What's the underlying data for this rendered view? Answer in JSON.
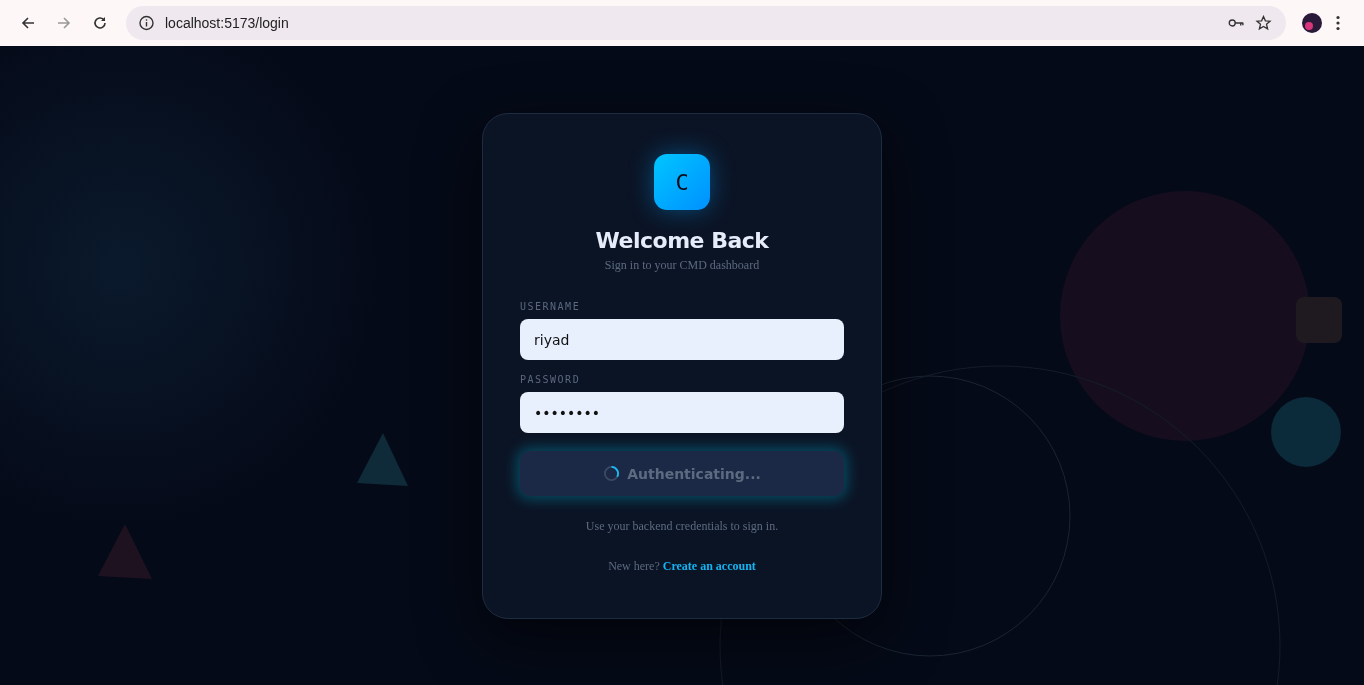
{
  "browser": {
    "url": "localhost:5173/login"
  },
  "login": {
    "logo_letter": "C",
    "title": "Welcome Back",
    "subtitle": "Sign in to your CMD dashboard",
    "fields": [
      {
        "label": "USERNAME",
        "value": "riyad"
      },
      {
        "label": "PASSWORD",
        "value": "••••••••"
      }
    ],
    "submit": {
      "label": "Authenticating...",
      "loading": true
    },
    "hint": "Use your backend credentials to sign in.",
    "signup_prompt": "New here?",
    "signup_link": "Create an account"
  }
}
